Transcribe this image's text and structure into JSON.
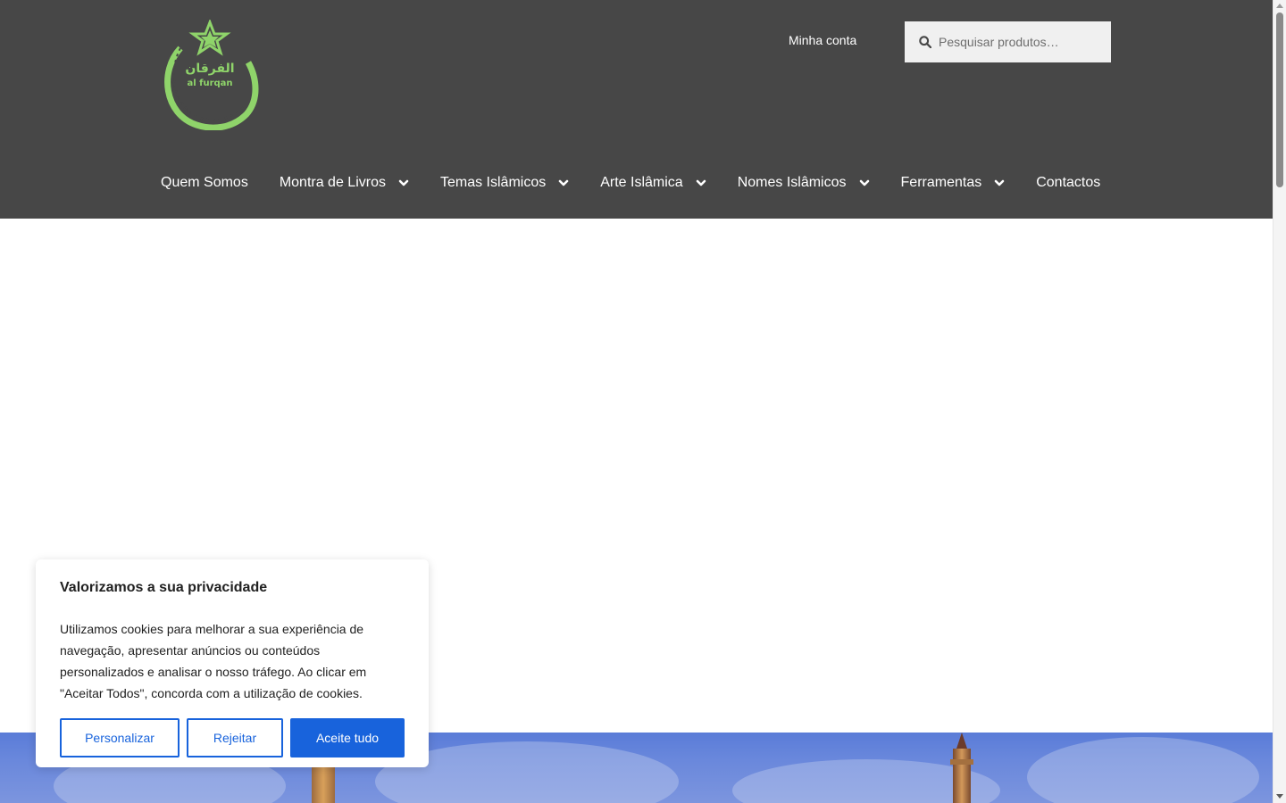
{
  "header": {
    "account_link": "Minha conta",
    "search": {
      "placeholder": "Pesquisar produtos…"
    },
    "logo": {
      "arabic_text": "الفرقان",
      "latin_text": "al furqan"
    }
  },
  "nav": {
    "items": [
      {
        "label": "Quem Somos",
        "has_dropdown": false
      },
      {
        "label": "Montra de Livros",
        "has_dropdown": true
      },
      {
        "label": "Temas Islâmicos",
        "has_dropdown": true
      },
      {
        "label": "Arte Islâmica",
        "has_dropdown": true
      },
      {
        "label": "Nomes Islâmicos",
        "has_dropdown": true
      },
      {
        "label": "Ferramentas",
        "has_dropdown": true
      },
      {
        "label": "Contactos",
        "has_dropdown": false
      }
    ]
  },
  "cookie_banner": {
    "title": "Valorizamos a sua privacidade",
    "text": "Utilizamos cookies para melhorar a sua experiência de navegação, apresentar anúncios ou conteúdos personalizados e analisar o nosso tráfego. Ao clicar em \"Aceitar Todos\", concorda com a utilização de cookies.",
    "customize_label": "Personalizar",
    "reject_label": "Rejeitar",
    "accept_label": "Aceite tudo"
  },
  "colors": {
    "header_bg": "#474747",
    "logo_green": "#8fd46a",
    "accent_blue": "#1863dc"
  },
  "icons": {
    "search": "search-icon",
    "dropdown": "chevron-down-icon"
  }
}
